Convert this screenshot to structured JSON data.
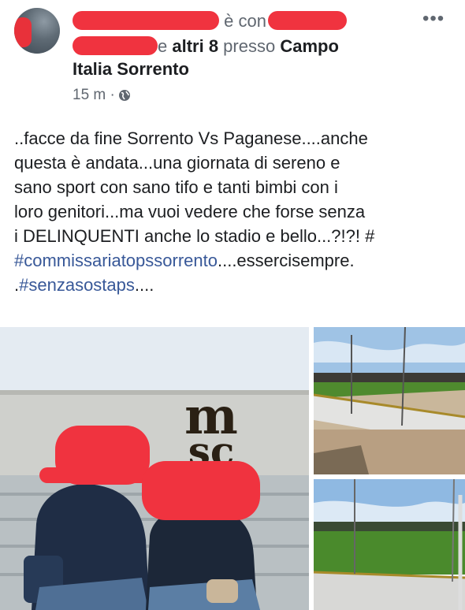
{
  "post": {
    "header": {
      "line1_suffix": "è con",
      "line2_middle": "e ",
      "line2_others": "altri 8",
      "line2_at": " presso ",
      "line2_place": "Campo",
      "line3_place": "Italia Sorrento",
      "time": "15 m ·"
    },
    "text": {
      "l1": "..facce da fine Sorrento Vs Paganese....anche",
      "l2": "questa è andata...una giornata di sereno e",
      "l3": "sano sport con sano tifo e tanti bimbi con i",
      "l4": "loro genitori...ma vuoi vedere che forse senza",
      "l5": "i DELINQUENTI anche lo stadio e bello...?!?! #",
      "l6_tag": "#commissariatopssorrento",
      "l6_rest": "....essercisempre.",
      "l7_dot": ".",
      "l7_tag": "#senzasostaps",
      "l7_rest": "...."
    },
    "photo_main": {
      "sign_line1": "m",
      "sign_line2": "sc"
    }
  },
  "icons": {
    "more": "more-options-icon",
    "globe": "globe-icon"
  },
  "colors": {
    "link": "#385898",
    "redaction": "#f0333f",
    "pitch": "#4f8a2e"
  }
}
